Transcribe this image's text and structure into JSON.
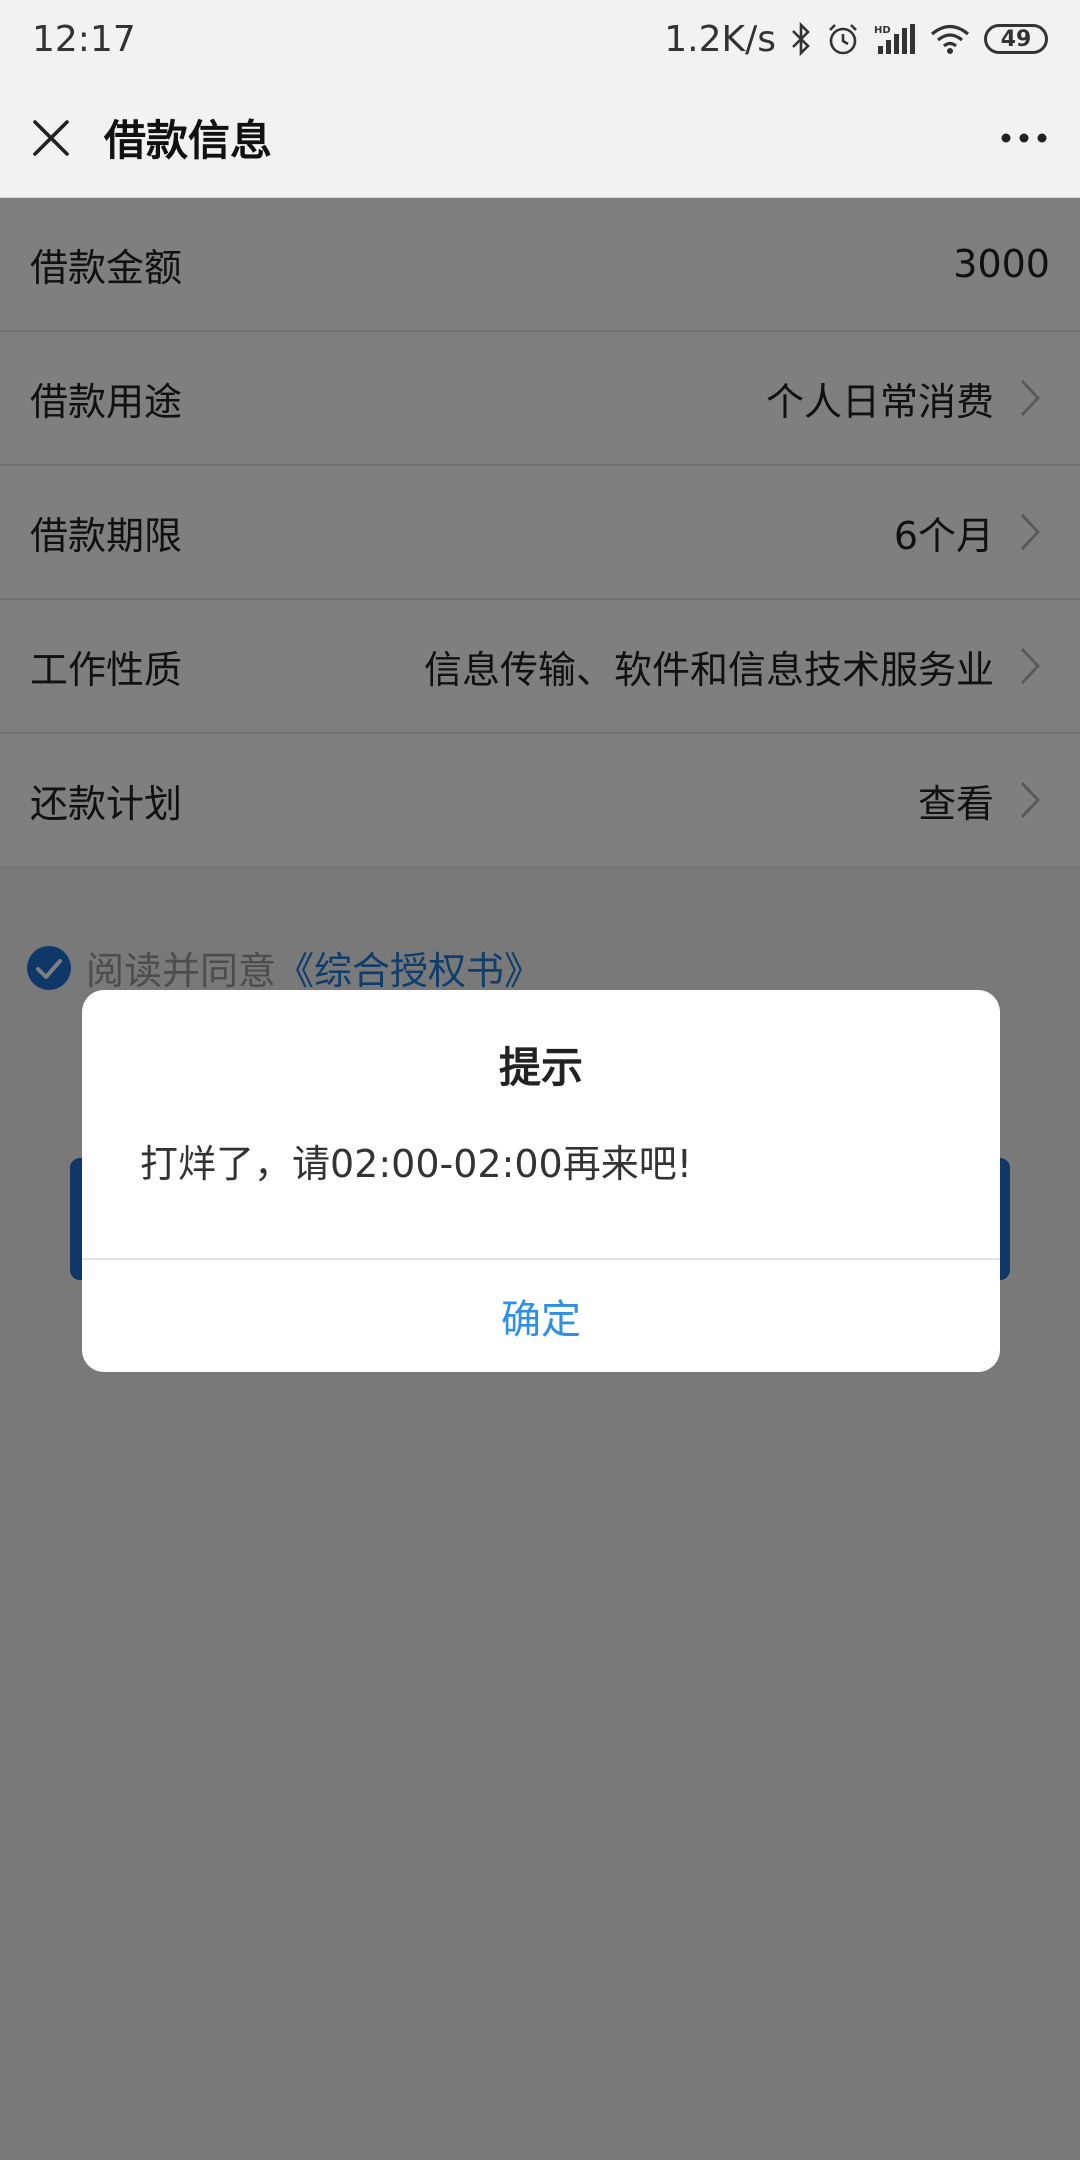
{
  "status_bar": {
    "time": "12:17",
    "net_speed": "1.2K/s",
    "battery": "49",
    "icons": [
      "bluetooth-icon",
      "alarm-icon",
      "hd-signal-icon",
      "wifi-icon",
      "battery-icon"
    ]
  },
  "nav": {
    "title": "借款信息",
    "close_icon": "close-icon",
    "more_icon": "more-icon"
  },
  "form": {
    "rows": [
      {
        "label": "借款金额",
        "value": "3000"
      },
      {
        "label": "借款用途",
        "value": "个人日常消费"
      },
      {
        "label": "借款期限",
        "value": "6个月"
      },
      {
        "label": "工作性质",
        "value": "信息传输、软件和信息技术服务业"
      },
      {
        "label": "还款计划",
        "value": "查看"
      }
    ]
  },
  "agreement": {
    "checked": true,
    "text": "阅读并同意",
    "link": "《综合授权书》"
  },
  "dialog": {
    "title": "提示",
    "message": "打烊了，请02:00-02:00再来吧!",
    "ok_label": "确定"
  },
  "colors": {
    "accent": "#1e7bd9",
    "dialog_button": "#2f8fe6",
    "overlay": "rgba(0,0,0,0.5)"
  }
}
